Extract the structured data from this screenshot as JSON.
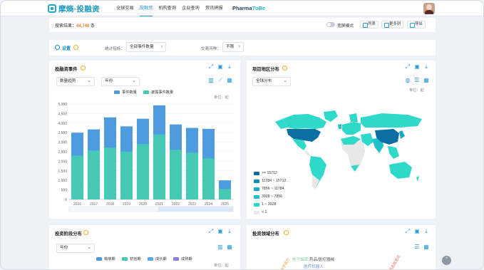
{
  "app": {
    "logo_text": "摩熵·投融资",
    "nav": [
      "全球交易",
      "投融资",
      "机构查询",
      "企业查询",
      "资讯研报"
    ],
    "active_nav_index": 1,
    "pharma_prefix": "Pharma",
    "pharma_suffix": "ToBe",
    "accent_color": "#1c8fc4"
  },
  "resultbar": {
    "label": "搜索结果：",
    "count": "44,740",
    "unit": " 条",
    "toggle_label": "宽屏模式",
    "toggle_on": false,
    "buttons": [
      "列表",
      "更多列",
      "导出"
    ]
  },
  "settings": {
    "title": "设置",
    "metric_label": "统计指标：",
    "metric_value": "全部事件数量",
    "currency_label": "交易币种：",
    "currency_value": "不限"
  },
  "panel1": {
    "title": "投融资事件",
    "select1": "数量趋势",
    "select2": "年份",
    "unit": "单位：起",
    "legend": [
      {
        "name": "事件数量",
        "color": "#4f9be0"
      },
      {
        "name": "披露事件数量",
        "color": "#46c9b5"
      }
    ]
  },
  "panel2": {
    "title": "项目地区分布",
    "select": "全球分布",
    "unit": "单位：起",
    "legend": [
      {
        "label": ">= 15712",
        "color": "#0c6fa3"
      },
      {
        "label": "11784 ~ 15712",
        "color": "#138eb8"
      },
      {
        "label": "7856 ~ 11784",
        "color": "#19a9c4"
      },
      {
        "label": "3928 ~ 7856",
        "color": "#1fc2c8"
      },
      {
        "label": "1 ~ 3928",
        "color": "#2fd9c9"
      },
      {
        "label": "< 1",
        "color": "#e8e8e8"
      }
    ]
  },
  "panel3": {
    "title": "投资阶段分布",
    "select": "年份",
    "unit": "单位：起",
    "legend": [
      {
        "name": "萌芽期",
        "color": "#4f9be0"
      },
      {
        "name": "初创期",
        "color": "#46c9b5"
      },
      {
        "name": "成长期",
        "color": "#5aa8e8"
      },
      {
        "name": "成熟期",
        "color": "#8c7fe0"
      }
    ]
  },
  "panel4": {
    "title": "投资领域分布",
    "cloud_words": [
      "电子烟草",
      "药品/医疗器械",
      "医疗机器人",
      "数字医疗",
      "药品信息化"
    ]
  },
  "chart_data": {
    "type": "bar",
    "title": "",
    "xlabel": "",
    "ylabel": "",
    "categories": [
      "2016",
      "2017",
      "2018",
      "2019",
      "2020",
      "2021",
      "2022",
      "2023",
      "2024",
      "2025"
    ],
    "series": [
      {
        "name": "事件数量",
        "values": [
          3500,
          3670,
          4300,
          3830,
          4230,
          4930,
          3930,
          3750,
          3700,
          1000
        ]
      },
      {
        "name": "披露事件数量",
        "values": [
          2300,
          2570,
          2720,
          2500,
          2900,
          3400,
          2600,
          2450,
          2150,
          550
        ]
      }
    ],
    "ylim": [
      0,
      5000
    ],
    "yticks": [
      "0",
      "500",
      "1,000",
      "1,500",
      "2,000",
      "2,500",
      "3,000",
      "3,500",
      "4,000",
      "4,500",
      "5,000"
    ],
    "grid": true,
    "legend": "top"
  }
}
